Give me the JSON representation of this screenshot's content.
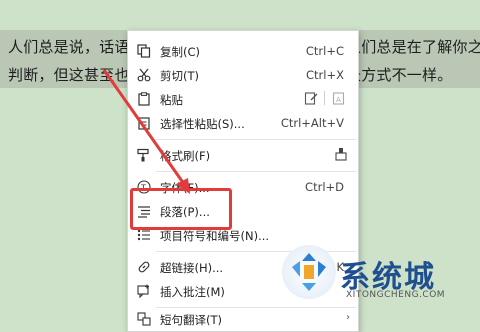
{
  "document": {
    "line1": "人们总是说，话语不",
    "line1_right": "人们总是在了解你之",
    "line2": "判断，但这甚至也可",
    "line2_right": "长方式不一样。"
  },
  "context_menu": {
    "items": [
      {
        "label": "复制(C)",
        "shortcut": "Ctrl+C",
        "icon": "copy-icon"
      },
      {
        "label": "剪切(T)",
        "shortcut": "Ctrl+X",
        "icon": "scissors-icon"
      },
      {
        "label": "粘贴",
        "shortcut": "",
        "icon": "paste-icon"
      },
      {
        "label": "选择性粘贴(S)...",
        "shortcut": "Ctrl+Alt+V",
        "icon": "paste-special-icon"
      },
      {
        "label": "格式刷(F)",
        "shortcut": "",
        "icon": "format-painter-icon"
      },
      {
        "label": "字体(F)...",
        "shortcut": "Ctrl+D",
        "icon": "font-icon"
      },
      {
        "label": "段落(P)...",
        "shortcut": "",
        "icon": "paragraph-icon"
      },
      {
        "label": "项目符号和编号(N)...",
        "shortcut": "",
        "icon": "bullets-icon"
      },
      {
        "label": "超链接(H)...",
        "shortcut": "K",
        "icon": "link-icon"
      },
      {
        "label": "插入批注(M)",
        "shortcut": "",
        "icon": "comment-icon"
      },
      {
        "label": "短句翻译(T)",
        "shortcut": "",
        "icon": "translate-icon"
      }
    ]
  },
  "watermark": {
    "title": "系统城",
    "url": "XITONGCHENG.COM"
  },
  "colors": {
    "highlight_box": "#e23b3b",
    "arrow": "#e23b3b",
    "document_bg": "#cde2c9"
  }
}
